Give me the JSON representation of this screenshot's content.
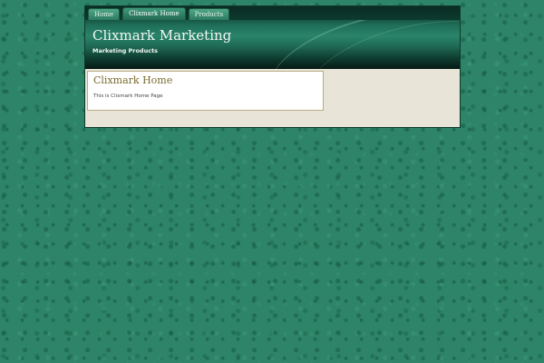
{
  "nav": {
    "tabs": [
      {
        "label": "Home"
      },
      {
        "label": "Clixmark Home"
      },
      {
        "label": "Products"
      }
    ]
  },
  "header": {
    "title": "Clixmark Marketing",
    "subtitle": "Marketing Products"
  },
  "main": {
    "page_title": "Clixmark Home",
    "body_text": "This is Clixmark Home Page"
  }
}
